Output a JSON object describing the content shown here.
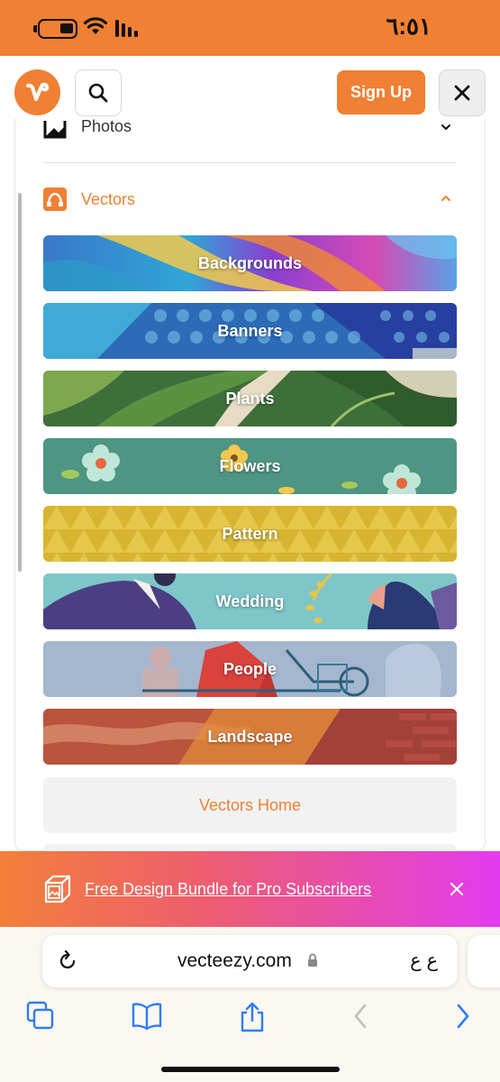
{
  "status_bar": {
    "time": "٦:٥١"
  },
  "header": {
    "signup_label": "Sign Up"
  },
  "menu": {
    "photos_label": "Photos",
    "vectors_label": "Vectors",
    "categories": [
      {
        "label": "Backgrounds"
      },
      {
        "label": "Banners"
      },
      {
        "label": "Plants"
      },
      {
        "label": "Flowers"
      },
      {
        "label": "Pattern"
      },
      {
        "label": "Wedding"
      },
      {
        "label": "People"
      },
      {
        "label": "Landscape"
      }
    ],
    "vectors_home_label": "Vectors Home"
  },
  "promo": {
    "text": "Free Design Bundle for Pro Subscribers"
  },
  "browser": {
    "url": "vecteezy.com",
    "reader_label": "ع ع"
  },
  "colors": {
    "brand": "#F08033",
    "promo_start": "#F2803A",
    "promo_end": "#E43BF0",
    "ios_blue": "#2F7CF6"
  },
  "icons": [
    "battery-icon",
    "wifi-icon",
    "signal-icon",
    "vecteezy-logo",
    "search-icon",
    "close-icon",
    "photo-icon",
    "chevron-down-icon",
    "vectors-icon",
    "chevron-up-icon",
    "gift-box-icon",
    "reload-icon",
    "lock-icon",
    "tabs-icon",
    "bookmarks-icon",
    "share-icon",
    "back-icon",
    "forward-icon"
  ]
}
